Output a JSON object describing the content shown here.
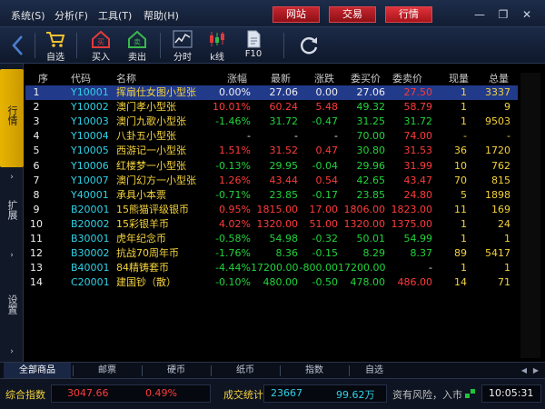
{
  "menu": [
    "系统(S)",
    "分析(F)",
    "工具(T)",
    "帮助(H)"
  ],
  "topbuttons": [
    "网站",
    "交易",
    "行情"
  ],
  "window_controls": [
    "minimize-icon",
    "restore-icon",
    "close-icon"
  ],
  "toolbar": {
    "items": [
      {
        "label": "自选",
        "icon": "cart-icon"
      },
      {
        "label": "买入",
        "icon": "house-buy-icon"
      },
      {
        "label": "卖出",
        "icon": "house-sell-icon"
      },
      {
        "label": "分时",
        "icon": "intraday-chart-icon"
      },
      {
        "label": "k线",
        "icon": "candlestick-icon"
      },
      {
        "label": "F10",
        "icon": "document-icon"
      }
    ],
    "refresh_icon": "refresh-icon",
    "back_icon": "back-arrow-icon"
  },
  "left_tabs": [
    "行情",
    "扩展",
    "设置"
  ],
  "columns": [
    "序",
    "代码",
    "名称",
    "涨幅",
    "最新",
    "涨跌",
    "委买价",
    "委卖价",
    "现量",
    "总量"
  ],
  "rows": [
    {
      "no": "1",
      "code": "Y10001",
      "name": "挥扇仕女图小型张",
      "pct": "0.00%",
      "last": "27.06",
      "chg": "0.00",
      "bid": "27.06",
      "ask": "27.50",
      "vol": "1",
      "total": "3337",
      "pc": "white",
      "lc": "white",
      "cc": "white",
      "bc": "white",
      "ac": "red"
    },
    {
      "no": "2",
      "code": "Y10002",
      "name": "澳门孝小型张",
      "pct": "10.01%",
      "last": "60.24",
      "chg": "5.48",
      "bid": "49.32",
      "ask": "58.79",
      "vol": "1",
      "total": "9",
      "pc": "red",
      "lc": "red",
      "cc": "red",
      "bc": "green",
      "ac": "red"
    },
    {
      "no": "3",
      "code": "Y10003",
      "name": "澳门九歌小型张",
      "pct": "-1.46%",
      "last": "31.72",
      "chg": "-0.47",
      "bid": "31.25",
      "ask": "31.72",
      "vol": "1",
      "total": "9503",
      "pc": "green",
      "lc": "green",
      "cc": "green",
      "bc": "green",
      "ac": "green"
    },
    {
      "no": "4",
      "code": "Y10004",
      "name": "八卦五小型张",
      "pct": "-",
      "last": "-",
      "chg": "-",
      "bid": "70.00",
      "ask": "74.00",
      "vol": "-",
      "total": "-",
      "pc": "white",
      "lc": "white",
      "cc": "white",
      "bc": "green",
      "ac": "red"
    },
    {
      "no": "5",
      "code": "Y10005",
      "name": "西游记一小型张",
      "pct": "1.51%",
      "last": "31.52",
      "chg": "0.47",
      "bid": "30.80",
      "ask": "31.53",
      "vol": "36",
      "total": "1720",
      "pc": "red",
      "lc": "red",
      "cc": "red",
      "bc": "green",
      "ac": "red"
    },
    {
      "no": "6",
      "code": "Y10006",
      "name": "红楼梦一小型张",
      "pct": "-0.13%",
      "last": "29.95",
      "chg": "-0.04",
      "bid": "29.96",
      "ask": "31.99",
      "vol": "10",
      "total": "762",
      "pc": "green",
      "lc": "green",
      "cc": "green",
      "bc": "green",
      "ac": "red"
    },
    {
      "no": "7",
      "code": "Y10007",
      "name": "澳门幻方一小型张",
      "pct": "1.26%",
      "last": "43.44",
      "chg": "0.54",
      "bid": "42.65",
      "ask": "43.47",
      "vol": "70",
      "total": "815",
      "pc": "red",
      "lc": "red",
      "cc": "red",
      "bc": "green",
      "ac": "red"
    },
    {
      "no": "8",
      "code": "Y40001",
      "name": "承具小本票",
      "pct": "-0.71%",
      "last": "23.85",
      "chg": "-0.17",
      "bid": "23.85",
      "ask": "24.80",
      "vol": "5",
      "total": "1898",
      "pc": "green",
      "lc": "green",
      "cc": "green",
      "bc": "green",
      "ac": "red"
    },
    {
      "no": "9",
      "code": "B20001",
      "name": "15熊猫评级银币",
      "pct": "0.95%",
      "last": "1815.00",
      "chg": "17.00",
      "bid": "1806.00",
      "ask": "1823.00",
      "vol": "11",
      "total": "169",
      "pc": "red",
      "lc": "red",
      "cc": "red",
      "bc": "red",
      "ac": "red"
    },
    {
      "no": "10",
      "code": "B20002",
      "name": "15彩银羊币",
      "pct": "4.02%",
      "last": "1320.00",
      "chg": "51.00",
      "bid": "1320.00",
      "ask": "1375.00",
      "vol": "1",
      "total": "24",
      "pc": "red",
      "lc": "red",
      "cc": "red",
      "bc": "red",
      "ac": "red"
    },
    {
      "no": "11",
      "code": "B30001",
      "name": "虎年纪念币",
      "pct": "-0.58%",
      "last": "54.98",
      "chg": "-0.32",
      "bid": "50.01",
      "ask": "54.99",
      "vol": "1",
      "total": "1",
      "pc": "green",
      "lc": "green",
      "cc": "green",
      "bc": "green",
      "ac": "green"
    },
    {
      "no": "12",
      "code": "B30002",
      "name": "抗战70周年币",
      "pct": "-1.76%",
      "last": "8.36",
      "chg": "-0.15",
      "bid": "8.29",
      "ask": "8.37",
      "vol": "89",
      "total": "5417",
      "pc": "green",
      "lc": "green",
      "cc": "green",
      "bc": "green",
      "ac": "green"
    },
    {
      "no": "13",
      "code": "B40001",
      "name": "84精铸套币",
      "pct": "-4.44%",
      "last": "17200.00",
      "chg": "-800.00",
      "bid": "17200.00",
      "ask": "-",
      "vol": "1",
      "total": "1",
      "pc": "green",
      "lc": "green",
      "cc": "green",
      "bc": "green",
      "ac": "white"
    },
    {
      "no": "14",
      "code": "C20001",
      "name": "建国钞（散）",
      "pct": "-0.10%",
      "last": "480.00",
      "chg": "-0.50",
      "bid": "478.00",
      "ask": "486.00",
      "vol": "14",
      "total": "71",
      "pc": "green",
      "lc": "green",
      "cc": "green",
      "bc": "green",
      "ac": "red"
    }
  ],
  "bottom_tabs": [
    "全部商品",
    "邮票",
    "硬币",
    "纸币",
    "指数",
    "自选"
  ],
  "status": {
    "index_label": "综合指数",
    "index_value": "3047.66",
    "index_pct": "0.49%",
    "stat_label": "成交统计",
    "stat_count": "23667",
    "stat_amount": "99.62万",
    "notice": "资有风险，入市",
    "time": "10:05:31"
  }
}
